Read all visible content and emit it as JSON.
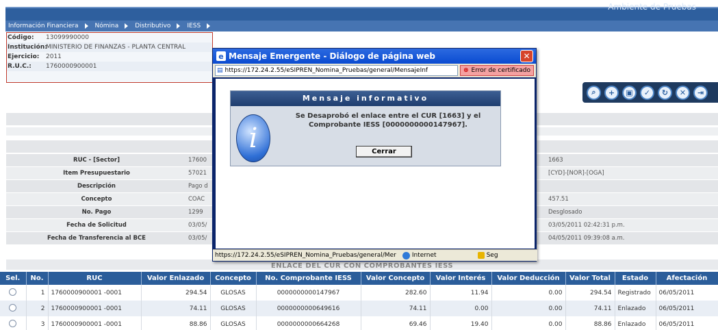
{
  "header": {
    "environment": "Ambiente de Pruebas"
  },
  "menu": [
    "Información Financiera",
    "Nómina",
    "Distributivo",
    "IESS"
  ],
  "info": [
    {
      "key": "Código:",
      "value": "13099990000"
    },
    {
      "key": "Institución:",
      "value": "MINISTERIO DE FINANZAS - PLANTA CENTRAL"
    },
    {
      "key": "Ejercicio:",
      "value": "2011"
    },
    {
      "key": "R.U.C.:",
      "value": "1760000900001"
    }
  ],
  "toolbar": {
    "icons": [
      "search-icon",
      "add-icon",
      "save-icon",
      "approve-icon",
      "refresh-icon",
      "cancel-icon",
      "exit-icon"
    ]
  },
  "details": [
    {
      "label": "RUC - [Sector]",
      "value": "17600",
      "right": "1663"
    },
    {
      "label": "Item Presupuestario",
      "value": "57021",
      "right": "[CYD]-[NOR]-[OGA]"
    },
    {
      "label": "Descripción",
      "value": "Pago d",
      "right": ""
    },
    {
      "label": "Concepto",
      "value": "COAC",
      "right": "457.51"
    },
    {
      "label": "No. Pago",
      "value": "1299",
      "right": "Desglosado"
    },
    {
      "label": "Fecha de Solicitud",
      "value": "03/05/",
      "right": "03/05/2011 02:42:31 p.m."
    },
    {
      "label": "Fecha de Transferencia al BCE",
      "value": "03/05/",
      "right": "04/05/2011 09:39:08 a.m."
    }
  ],
  "enlace_title": "ENLACE DEL CUR CON COMPROBANTES IESS",
  "table": {
    "headers": [
      "Sel.",
      "No.",
      "RUC",
      "Valor Enlazado",
      "Concepto",
      "No. Comprobante IESS",
      "Valor Concepto",
      "Valor Interés",
      "Valor Deducción",
      "Valor Total",
      "Estado",
      "Afectación"
    ],
    "rows": [
      {
        "no": "1",
        "ruc": "1760000900001 -0001",
        "valor_enlazado": "294.54",
        "concepto": "GLOSAS",
        "comprobante": "0000000000147967",
        "valor_concepto": "282.60",
        "valor_interes": "11.94",
        "valor_deduccion": "0.00",
        "valor_total": "294.54",
        "estado": "Registrado",
        "afectacion": "06/05/2011"
      },
      {
        "no": "2",
        "ruc": "1760000900001 -0001",
        "valor_enlazado": "74.11",
        "concepto": "GLOSAS",
        "comprobante": "0000000000649616",
        "valor_concepto": "74.11",
        "valor_interes": "0.00",
        "valor_deduccion": "0.00",
        "valor_total": "74.11",
        "estado": "Enlazado",
        "afectacion": "06/05/2011"
      },
      {
        "no": "3",
        "ruc": "1760000900001 -0001",
        "valor_enlazado": "88.86",
        "concepto": "GLOSAS",
        "comprobante": "0000000000664268",
        "valor_concepto": "69.46",
        "valor_interes": "19.40",
        "valor_deduccion": "0.00",
        "valor_total": "88.86",
        "estado": "Enlazado",
        "afectacion": "06/05/2011"
      }
    ]
  },
  "dialog": {
    "title": "Mensaje Emergente - Diálogo de página web",
    "url": "https://172.24.2.55/eSIPREN_Nomina_Pruebas/general/MensajeInf",
    "cert_error": "Error de certificado",
    "header": "Mensaje informativo",
    "message": "Se Desaprobó el enlace entre el CUR [1663] y el Comprobante IESS [0000000000147967].",
    "button": "Cerrar",
    "status_url": "https://172.24.2.55/eSIPREN_Nomina_Pruebas/general/Mer",
    "zone": "Internet",
    "secure": "Seg"
  }
}
